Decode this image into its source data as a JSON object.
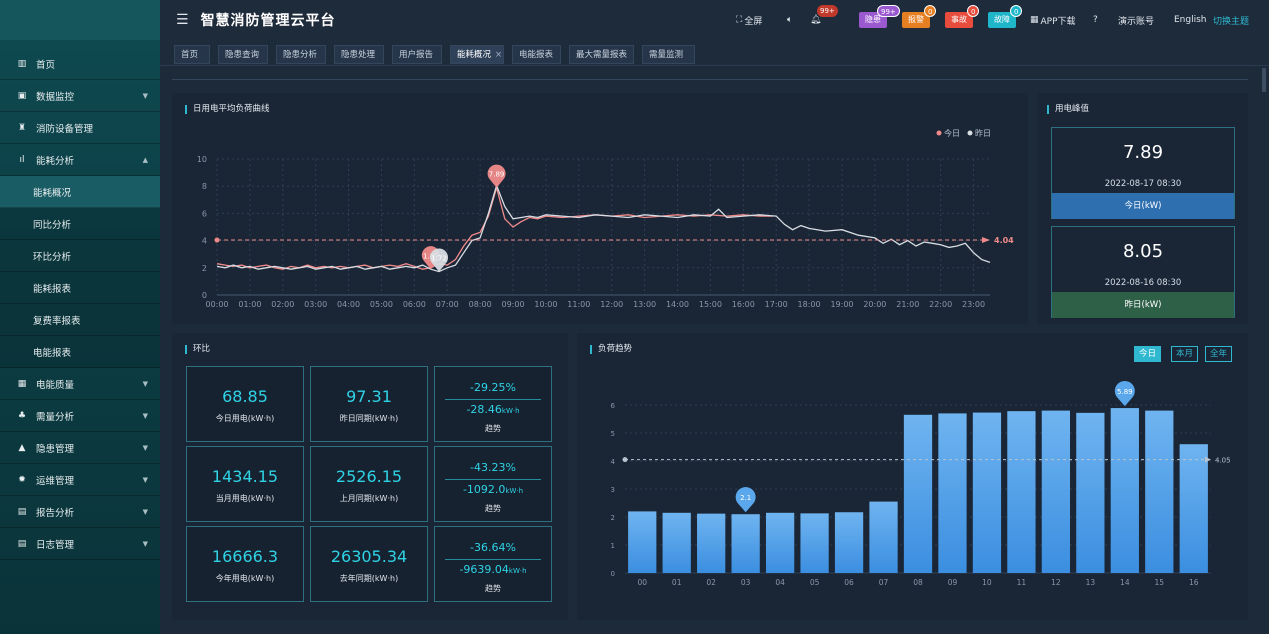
{
  "header": {
    "title": "智慧消防管理云平台",
    "fullscreen": "全屏",
    "notice_count": "99+",
    "tags": [
      {
        "label": "隐患",
        "count": "99+",
        "color": "#9b59d0",
        "badge_color": "#9b59d0"
      },
      {
        "label": "报警",
        "count": "0",
        "color": "#e67e22",
        "badge_color": "#e67e22"
      },
      {
        "label": "事故",
        "count": "0",
        "color": "#e74c3c",
        "badge_color": "#e74c3c"
      },
      {
        "label": "故障",
        "count": "0",
        "color": "#1fb6c9",
        "badge_color": "#1fb6c9"
      }
    ],
    "app_download": "APP下载",
    "account": "演示账号",
    "language": "English",
    "theme": "切换主题"
  },
  "sidebar": {
    "items": [
      {
        "label": "首页",
        "icon": "home-icon",
        "glyph": "▥",
        "arrow": false
      },
      {
        "label": "数据监控",
        "icon": "monitor-icon",
        "glyph": "▣",
        "arrow": true
      },
      {
        "label": "消防设备管理",
        "icon": "extinguisher-icon",
        "glyph": "♜",
        "arrow": false
      },
      {
        "label": "能耗分析",
        "icon": "bar-chart-icon",
        "glyph": "ıl",
        "arrow": true,
        "expanded": true
      },
      {
        "label": "电能质量",
        "icon": "calendar-icon",
        "glyph": "▦",
        "arrow": true
      },
      {
        "label": "需量分析",
        "icon": "network-icon",
        "glyph": "♣",
        "arrow": true
      },
      {
        "label": "隐患管理",
        "icon": "warning-icon",
        "glyph": "▲",
        "arrow": true
      },
      {
        "label": "运维管理",
        "icon": "gear-icon",
        "glyph": "✹",
        "arrow": true
      },
      {
        "label": "报告分析",
        "icon": "report-icon",
        "glyph": "▤",
        "arrow": true
      },
      {
        "label": "日志管理",
        "icon": "log-icon",
        "glyph": "▤",
        "arrow": true
      }
    ],
    "sub_items": [
      "能耗概况",
      "同比分析",
      "环比分析",
      "能耗报表",
      "复费率报表",
      "电能报表"
    ],
    "active_sub": "能耗概况"
  },
  "tabs": [
    "首页",
    "隐患查询",
    "隐患分析",
    "隐患处理",
    "用户报告",
    "能耗概况",
    "电能报表",
    "最大需量报表",
    "需量监测"
  ],
  "active_tab": "能耗概况",
  "tab_close": "×",
  "load_curve": {
    "title": "日用电平均负荷曲线",
    "legend_today": "今日",
    "legend_yesterday": "昨日",
    "mark_line_value": "4.04"
  },
  "peak": {
    "title": "用电峰值",
    "today_value": "7.89",
    "today_date": "2022-08-17 08:30",
    "today_label": "今日(kW)",
    "yesterday_value": "8.05",
    "yesterday_date": "2022-08-16 08:30",
    "yesterday_label": "昨日(kW)"
  },
  "huanbi": {
    "title": "环比",
    "rows": [
      {
        "cur": "68.85",
        "cur_label": "今日用电(kW·h)",
        "prev": "97.31",
        "prev_label": "昨日同期(kW·h)",
        "pct": "-29.25%",
        "diff": "-28.46",
        "unit": "kW·h",
        "trend": "趋势"
      },
      {
        "cur": "1434.15",
        "cur_label": "当月用电(kW·h)",
        "prev": "2526.15",
        "prev_label": "上月同期(kW·h)",
        "pct": "-43.23%",
        "diff": "-1092.0",
        "unit": "kW·h",
        "trend": "趋势"
      },
      {
        "cur": "16666.3",
        "cur_label": "今年用电(kW·h)",
        "prev": "26305.34",
        "prev_label": "去年同期(kW·h)",
        "pct": "-36.64%",
        "diff": "-9639.04",
        "unit": "kW·h",
        "trend": "趋势"
      }
    ]
  },
  "load_trend": {
    "title": "负荷趋势",
    "buttons": [
      "今日",
      "本月",
      "全年"
    ],
    "active_button": "今日"
  },
  "chart_data": [
    {
      "type": "line",
      "title": "日用电平均负荷曲线",
      "x_ticks": [
        "00:00",
        "01:00",
        "02:00",
        "03:00",
        "04:00",
        "05:00",
        "06:00",
        "07:00",
        "08:00",
        "09:00",
        "10:00",
        "11:00",
        "12:00",
        "13:00",
        "14:00",
        "15:00",
        "16:00",
        "17:00",
        "18:00",
        "19:00",
        "20:00",
        "21:00",
        "22:00",
        "23:00"
      ],
      "ylim": [
        0,
        10
      ],
      "y_ticks": [
        0,
        2,
        4,
        6,
        8,
        10
      ],
      "series": [
        {
          "name": "今日",
          "color": "#f08a8a",
          "points": [
            [
              0,
              2.3
            ],
            [
              0.25,
              2.2
            ],
            [
              0.5,
              2.1
            ],
            [
              0.75,
              2.2
            ],
            [
              1,
              2.0
            ],
            [
              1.25,
              2.1
            ],
            [
              1.5,
              2.2
            ],
            [
              1.75,
              2.0
            ],
            [
              2,
              1.9
            ],
            [
              2.25,
              2.1
            ],
            [
              2.5,
              2.0
            ],
            [
              2.75,
              2.2
            ],
            [
              3,
              2.0
            ],
            [
              3.25,
              2.1
            ],
            [
              3.5,
              2.0
            ],
            [
              3.75,
              2.1
            ],
            [
              4,
              2.0
            ],
            [
              4.25,
              2.1
            ],
            [
              4.5,
              2.2
            ],
            [
              4.75,
              2.0
            ],
            [
              5,
              2.1
            ],
            [
              5.25,
              2.2
            ],
            [
              5.5,
              2.1
            ],
            [
              5.75,
              2.3
            ],
            [
              6,
              2.1
            ],
            [
              6.25,
              1.9
            ],
            [
              6.5,
              2.0
            ],
            [
              6.75,
              2.3
            ],
            [
              7,
              2.2
            ],
            [
              7.25,
              2.6
            ],
            [
              7.5,
              3.6
            ],
            [
              7.75,
              4.4
            ],
            [
              8,
              4.6
            ],
            [
              8.25,
              5.8
            ],
            [
              8.5,
              7.89
            ],
            [
              8.75,
              5.6
            ],
            [
              9,
              5.0
            ],
            [
              9.25,
              5.4
            ],
            [
              9.5,
              5.7
            ],
            [
              9.75,
              5.6
            ],
            [
              10,
              5.8
            ],
            [
              10.5,
              5.7
            ],
            [
              11,
              5.8
            ],
            [
              11.5,
              5.9
            ],
            [
              12,
              5.8
            ],
            [
              12.5,
              5.9
            ],
            [
              13,
              5.7
            ],
            [
              13.5,
              5.8
            ],
            [
              14,
              5.9
            ],
            [
              14.5,
              5.8
            ],
            [
              15,
              5.9
            ],
            [
              15.5,
              5.8
            ],
            [
              16,
              5.9
            ],
            [
              16.5,
              5.8
            ],
            [
              16.9,
              5.8
            ]
          ]
        },
        {
          "name": "昨日",
          "color": "#d8dde3",
          "points": [
            [
              0,
              2.1
            ],
            [
              0.25,
              2.0
            ],
            [
              0.5,
              2.2
            ],
            [
              0.75,
              2.0
            ],
            [
              1,
              2.1
            ],
            [
              1.25,
              1.9
            ],
            [
              1.5,
              2.0
            ],
            [
              1.75,
              2.1
            ],
            [
              2,
              2.0
            ],
            [
              2.25,
              1.9
            ],
            [
              2.5,
              2.0
            ],
            [
              2.75,
              2.1
            ],
            [
              3,
              1.9
            ],
            [
              3.25,
              2.0
            ],
            [
              3.5,
              2.1
            ],
            [
              3.75,
              1.9
            ],
            [
              4,
              2.0
            ],
            [
              4.25,
              2.1
            ],
            [
              4.5,
              1.9
            ],
            [
              4.75,
              2.0
            ],
            [
              5,
              2.1
            ],
            [
              5.25,
              1.9
            ],
            [
              5.5,
              2.0
            ],
            [
              5.75,
              2.1
            ],
            [
              6,
              2.0
            ],
            [
              6.25,
              2.2
            ],
            [
              6.5,
              1.9
            ],
            [
              6.75,
              1.72
            ],
            [
              7,
              2.0
            ],
            [
              7.25,
              2.2
            ],
            [
              7.5,
              3.1
            ],
            [
              7.75,
              4.0
            ],
            [
              8,
              4.2
            ],
            [
              8.25,
              6.0
            ],
            [
              8.5,
              8.05
            ],
            [
              8.75,
              6.5
            ],
            [
              9,
              5.6
            ],
            [
              9.25,
              5.7
            ],
            [
              9.5,
              5.8
            ],
            [
              9.75,
              5.7
            ],
            [
              10,
              5.9
            ],
            [
              10.5,
              5.8
            ],
            [
              11,
              5.7
            ],
            [
              11.5,
              5.9
            ],
            [
              12,
              5.8
            ],
            [
              12.5,
              5.7
            ],
            [
              13,
              5.9
            ],
            [
              13.5,
              5.8
            ],
            [
              14,
              5.7
            ],
            [
              14.5,
              5.9
            ],
            [
              15,
              5.8
            ],
            [
              15.25,
              6.3
            ],
            [
              15.5,
              5.7
            ],
            [
              16,
              5.8
            ],
            [
              16.5,
              5.9
            ],
            [
              17,
              5.8
            ],
            [
              17.25,
              5.2
            ],
            [
              17.5,
              4.8
            ],
            [
              17.75,
              5.1
            ],
            [
              18,
              4.9
            ],
            [
              18.5,
              4.7
            ],
            [
              19,
              4.8
            ],
            [
              19.5,
              4.4
            ],
            [
              20,
              4.2
            ],
            [
              20.25,
              3.8
            ],
            [
              20.5,
              4.1
            ],
            [
              20.75,
              3.7
            ],
            [
              21,
              4.0
            ],
            [
              21.25,
              3.6
            ],
            [
              21.5,
              3.9
            ],
            [
              21.75,
              3.8
            ],
            [
              22,
              3.7
            ],
            [
              22.25,
              3.5
            ],
            [
              22.5,
              3.6
            ],
            [
              22.75,
              3.8
            ],
            [
              23,
              3.1
            ],
            [
              23.25,
              2.6
            ],
            [
              23.5,
              2.4
            ]
          ]
        }
      ],
      "markers": [
        {
          "series": "今日",
          "x": 8.5,
          "y": 7.89,
          "label": "7.89"
        },
        {
          "series": "今日",
          "x": 6.5,
          "y": 1.89,
          "label": "1.89"
        },
        {
          "series": "昨日",
          "x": 6.75,
          "y": 1.72,
          "label": "1.72"
        }
      ],
      "mark_line": 4.04
    },
    {
      "type": "bar",
      "title": "负荷趋势",
      "categories": [
        "00",
        "01",
        "02",
        "03",
        "04",
        "05",
        "06",
        "07",
        "08",
        "09",
        "10",
        "11",
        "12",
        "13",
        "14",
        "15",
        "16"
      ],
      "values": [
        2.2,
        2.15,
        2.12,
        2.1,
        2.15,
        2.13,
        2.17,
        2.55,
        5.65,
        5.7,
        5.73,
        5.78,
        5.8,
        5.72,
        5.89,
        5.8,
        4.6
      ],
      "ylim": [
        0,
        6
      ],
      "y_ticks": [
        0,
        1,
        2,
        3,
        4,
        5,
        6
      ],
      "markers": [
        {
          "index": 3,
          "label": "2.1"
        },
        {
          "index": 14,
          "label": "5.89"
        }
      ],
      "mark_line": 4.05,
      "mark_line_label": "4.05",
      "color": "#3b8ee0"
    }
  ]
}
